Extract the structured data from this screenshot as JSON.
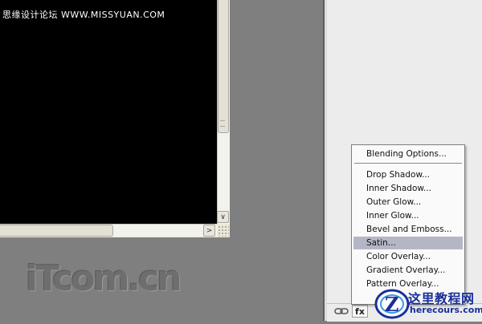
{
  "watermark": {
    "top_text": "思缘设计论坛 WWW.MISSYUAN.COM",
    "bottom_text": "iTcom.cn"
  },
  "document_window": {
    "scroll_down_arrow": "∨",
    "scroll_right_arrow": ">"
  },
  "layers_panel": {
    "link_icon": "link-icon",
    "fx_button_label": "fx"
  },
  "context_menu": {
    "items": [
      {
        "label": "Blending Options..."
      },
      {
        "label": "Drop Shadow..."
      },
      {
        "label": "Inner Shadow..."
      },
      {
        "label": "Outer Glow..."
      },
      {
        "label": "Inner Glow..."
      },
      {
        "label": "Bevel and Emboss..."
      },
      {
        "label": "Satin...",
        "selected": true
      },
      {
        "label": "Color Overlay..."
      },
      {
        "label": "Gradient Overlay..."
      },
      {
        "label": "Pattern Overlay..."
      }
    ]
  },
  "logo": {
    "title": "这里教程网",
    "url": "herecours.com",
    "mark": "Z"
  },
  "colors": {
    "workspace": "#7f7f7f",
    "canvas": "#000000",
    "menu_highlight": "#b5b6c5",
    "logo_blue": "#1a2f9a"
  }
}
